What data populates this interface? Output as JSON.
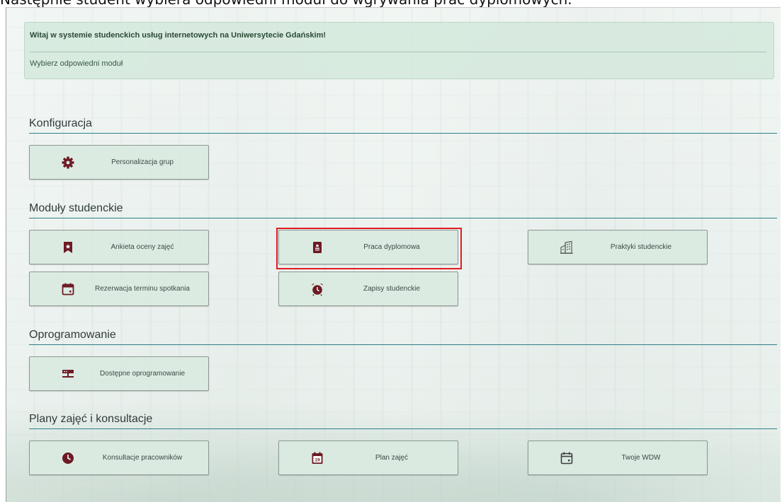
{
  "caption": "Następnie student wybiera odpowiedni moduł do wgrywania prac dyplomowych.",
  "colors": {
    "icon": "#6d1a24",
    "section_rule": "#2e7f8a",
    "highlight": "#e21b22",
    "alert_bg": "#d6e9dd"
  },
  "alert": {
    "title": "Witaj w systemie studenckich usług internetowych na Uniwersytecie Gdańskim!",
    "text": "Wybierz odpowiedni moduł"
  },
  "sections": {
    "konfiguracja": {
      "title": "Konfiguracja",
      "tiles": [
        {
          "label": "Personalizacja grup",
          "icon": "gear-icon"
        }
      ]
    },
    "moduly": {
      "title": "Moduły studenckie",
      "tiles": [
        {
          "label": "Ankieta oceny zajęć",
          "icon": "bookmark-star-icon"
        },
        {
          "label": "Praca dyplomowa",
          "icon": "thesis-document-icon",
          "highlighted": true
        },
        {
          "label": "Praktyki studenckie",
          "icon": "building-icon"
        },
        {
          "label": "Rezerwacja terminu spotkania",
          "icon": "calendar-icon"
        },
        {
          "label": "Zapisy studenckie",
          "icon": "alarm-clock-icon"
        }
      ]
    },
    "oprogramowanie": {
      "title": "Oprogramowanie",
      "tiles": [
        {
          "label": "Dostępne oprogramowanie",
          "icon": "network-server-icon"
        }
      ]
    },
    "plany": {
      "title": "Plany zajęć i konsultacje",
      "tiles": [
        {
          "label": "Konsultacje pracowników",
          "icon": "clock-icon"
        },
        {
          "label": "Plan zajęć",
          "icon": "calendar-date-icon",
          "day": "19"
        },
        {
          "label": "Twoje WDW",
          "icon": "calendar-outline-icon"
        }
      ]
    }
  }
}
